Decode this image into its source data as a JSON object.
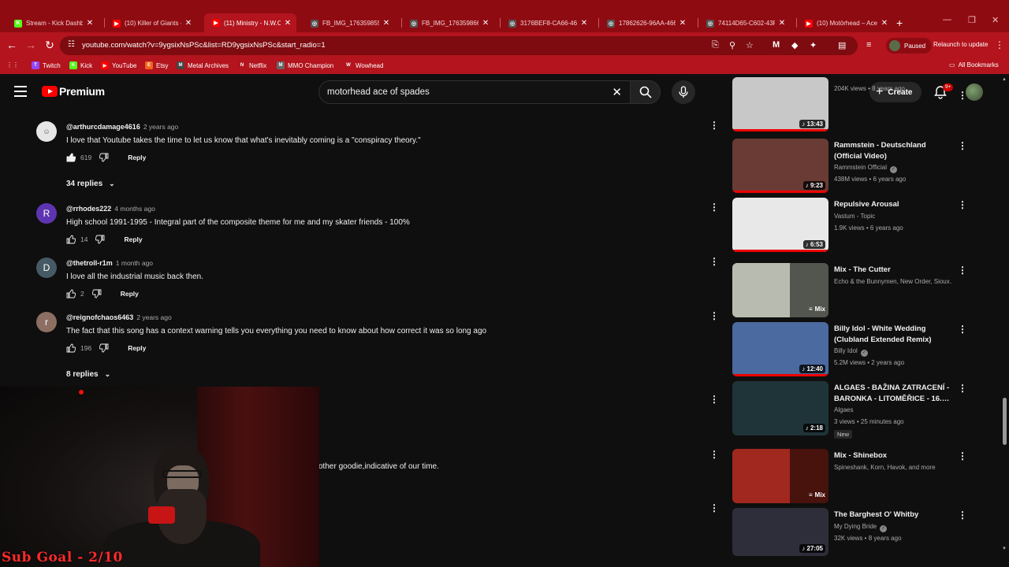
{
  "browser": {
    "tabs": [
      {
        "title": "Stream - Kick Dashbo",
        "icon": "K",
        "color": "#53fc18",
        "active": false
      },
      {
        "title": "(10) Killer of Giants - Y",
        "icon": "▶",
        "color": "#ff0000",
        "active": false
      },
      {
        "title": "(11) Ministry - N.W.O.",
        "icon": "▶",
        "color": "#ff0000",
        "active": true
      },
      {
        "title": "FB_IMG_1763598551",
        "icon": "◎",
        "color": "#555",
        "active": false
      },
      {
        "title": "FB_IMG_176359866",
        "icon": "◎",
        "color": "#555",
        "active": false
      },
      {
        "title": "3176BEF8-CA66-4689",
        "icon": "◎",
        "color": "#555",
        "active": false
      },
      {
        "title": "17862626-96AA-466",
        "icon": "◎",
        "color": "#555",
        "active": false
      },
      {
        "title": "74114D65-C602-43F",
        "icon": "◎",
        "color": "#555",
        "active": false
      },
      {
        "title": "(10) Motörhead – Ace",
        "icon": "▶",
        "color": "#ff0000",
        "active": false
      }
    ],
    "url": "youtube.com/watch?v=9ygsixNsPSc&list=RD9ygsixNsPSc&start_radio=1",
    "profile_label": "Paused",
    "relaunch_label": "Relaunch to update",
    "bookmarks": [
      {
        "label": "Twitch",
        "icon": "T",
        "color": "#9146ff"
      },
      {
        "label": "Kick",
        "icon": "K",
        "color": "#53fc18"
      },
      {
        "label": "YouTube",
        "icon": "▶",
        "color": "#ff0000"
      },
      {
        "label": "Etsy",
        "icon": "E",
        "color": "#f1641e"
      },
      {
        "label": "Metal Archives",
        "icon": "M",
        "color": "#444"
      },
      {
        "label": "Netflix",
        "icon": "N",
        "color": "#b3141d"
      },
      {
        "label": "MMO Champion",
        "icon": "M",
        "color": "#666"
      },
      {
        "label": "Wowhead",
        "icon": "W",
        "color": "#b3141d"
      }
    ],
    "all_bookmarks_label": "All Bookmarks"
  },
  "youtube": {
    "logo_text": "Premium",
    "search_query": "motorhead ace of spades",
    "create_label": "Create",
    "notif_badge": "9+"
  },
  "comments": [
    {
      "author": "@arthurcdamage4616",
      "date": "2 years ago",
      "text": "I love that Youtube takes the time to let us know that what's inevitably coming is a \"conspiracy theory.\"",
      "likes": "619",
      "reply_label": "Reply",
      "avatar_letter": "",
      "avatar_color": "#e6e6e6",
      "replies": "34 replies",
      "liked": true
    },
    {
      "author": "@rrhodes222",
      "date": "4 months ago",
      "text": "High school 1991-1995 - Integral part of the composite theme for me and my skater friends - 100%",
      "likes": "14",
      "reply_label": "Reply",
      "avatar_letter": "R",
      "avatar_color": "#5e35b1",
      "replies": ""
    },
    {
      "author": "@thetroll-r1m",
      "date": "1 month ago",
      "text": "I love all the industrial music back then.",
      "likes": "2",
      "reply_label": "Reply",
      "avatar_letter": "D",
      "avatar_color": "#455a64",
      "replies": ""
    },
    {
      "author": "@reignofchaos6463",
      "date": "2 years ago",
      "text": "The fact that this song has a context warning tells you everything you need to know about how correct it was so long ago",
      "likes": "196",
      "reply_label": "Reply",
      "avatar_letter": "r",
      "avatar_color": "#8d6e63",
      "replies": "8 replies"
    }
  ],
  "partial_comment_text": "other goodie,indicative of our time.",
  "overlay": {
    "sub_goal": "Sub Goal - 2/10"
  },
  "sidebar": [
    {
      "title": "",
      "channel": "",
      "meta": "204K views • 8 years ago",
      "duration": "13:43",
      "thumb": "#c8c8c8",
      "mix": false,
      "verified": false,
      "is_new": false
    },
    {
      "title": "Rammstein - Deutschland (Official Video)",
      "channel": "Rammstein Official",
      "meta": "438M views • 6 years ago",
      "duration": "9:23",
      "thumb": "#6a3a34",
      "mix": false,
      "verified": true,
      "is_new": false
    },
    {
      "title": "Repulsive Arousal",
      "channel": "Vastum - Topic",
      "meta": "1.9K views • 6 years ago",
      "duration": "6:53",
      "thumb": "#e8e8e8",
      "mix": false,
      "verified": false,
      "is_new": false
    },
    {
      "title": "Mix - The Cutter",
      "channel": "Echo & the Bunnymen, New Order, Sioux…",
      "meta": "",
      "duration": "Mix",
      "thumb": "#b8bcb0",
      "mix": true,
      "verified": false,
      "is_new": false
    },
    {
      "title": "Billy Idol - White Wedding (Clubland Extended Remix)",
      "channel": "Billy Idol",
      "meta": "5.2M views • 2 years ago",
      "duration": "12:40",
      "thumb": "#4a6aa0",
      "mix": false,
      "verified": true,
      "is_new": false
    },
    {
      "title": "ALGAES - BAŽINA ZATRACENÍ - BARONKA - LITOMĚŘICE - 16.…",
      "channel": "Algaes",
      "meta": "3 views • 25 minutes ago",
      "duration": "2:18",
      "thumb": "#1f3438",
      "mix": false,
      "verified": false,
      "is_new": true,
      "new_label": "New"
    },
    {
      "title": "Mix - Shinebox",
      "channel": "Spineshank, Korn, Havok, and more",
      "meta": "",
      "duration": "Mix",
      "thumb": "#a0281e",
      "mix": true,
      "verified": false,
      "is_new": false
    },
    {
      "title": "The Barghest O' Whitby",
      "channel": "My Dying Bride",
      "meta": "32K views • 8 years ago",
      "duration": "27:05",
      "thumb": "#2e2e3a",
      "mix": false,
      "verified": true,
      "is_new": false
    }
  ]
}
